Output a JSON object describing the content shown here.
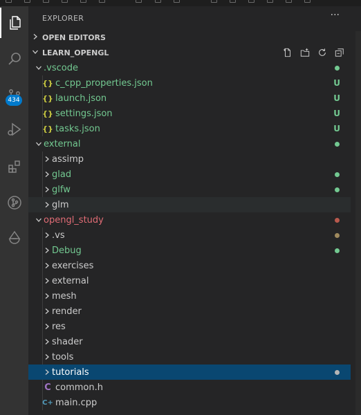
{
  "explorer": {
    "title": "EXPLORER",
    "more_label": "···",
    "open_editors_label": "OPEN EDITORS",
    "workspace_label": "LEARN_OPENGL"
  },
  "activity_bar": {
    "scm_badge": "434"
  },
  "colors": {
    "git_untracked": "#73c991",
    "git_modified_dot": "#73c991",
    "git_conflict_red": "#e06c75",
    "selected_row": "#094771",
    "accent": "#007acc"
  },
  "tree": [
    {
      "name": ".vscode",
      "type": "folder",
      "expanded": true,
      "color": "green",
      "deco": "dot",
      "dot_color": "#73c991"
    },
    {
      "name": "c_cpp_properties.json",
      "type": "json",
      "icon": "{}",
      "color": "green",
      "deco": "U"
    },
    {
      "name": "launch.json",
      "type": "json",
      "icon": "{}",
      "color": "green",
      "deco": "U"
    },
    {
      "name": "settings.json",
      "type": "json",
      "icon": "{}",
      "color": "green",
      "deco": "U"
    },
    {
      "name": "tasks.json",
      "type": "json",
      "icon": "{}",
      "color": "green",
      "deco": "U"
    },
    {
      "name": "external",
      "type": "folder",
      "expanded": true,
      "color": "green",
      "deco": "dot",
      "dot_color": "#73c991"
    },
    {
      "name": "assimp",
      "type": "folder",
      "expanded": false,
      "color": "white"
    },
    {
      "name": "glad",
      "type": "folder",
      "expanded": false,
      "color": "green",
      "deco": "dot",
      "dot_color": "#73c991"
    },
    {
      "name": "glfw",
      "type": "folder",
      "expanded": false,
      "color": "green",
      "deco": "dot",
      "dot_color": "#73c991"
    },
    {
      "name": "glm",
      "type": "folder",
      "expanded": false,
      "color": "white"
    },
    {
      "name": "opengl_study",
      "type": "folder",
      "expanded": true,
      "color": "red",
      "deco": "dot",
      "dot_color": "#b8594d"
    },
    {
      "name": ".vs",
      "type": "folder",
      "expanded": false,
      "color": "white",
      "deco": "dot",
      "dot_color": "#a08a5e"
    },
    {
      "name": "Debug",
      "type": "folder",
      "expanded": false,
      "color": "green",
      "deco": "dot",
      "dot_color": "#73c991"
    },
    {
      "name": "exercises",
      "type": "folder",
      "expanded": false,
      "color": "white"
    },
    {
      "name": "external",
      "type": "folder",
      "expanded": false,
      "color": "white"
    },
    {
      "name": "mesh",
      "type": "folder",
      "expanded": false,
      "color": "white"
    },
    {
      "name": "render",
      "type": "folder",
      "expanded": false,
      "color": "white"
    },
    {
      "name": "res",
      "type": "folder",
      "expanded": false,
      "color": "white"
    },
    {
      "name": "shader",
      "type": "folder",
      "expanded": false,
      "color": "white"
    },
    {
      "name": "tools",
      "type": "folder",
      "expanded": false,
      "color": "white"
    },
    {
      "name": "tutorials",
      "type": "folder",
      "expanded": false,
      "color": "white",
      "deco": "dot",
      "dot_color": "#b5b5b5",
      "selected": true
    },
    {
      "name": "common.h",
      "type": "c-header",
      "icon": "C",
      "icon_color": "#a074c4",
      "color": "white"
    },
    {
      "name": "main.cpp",
      "type": "cpp",
      "icon": "C+",
      "icon_color": "#519aba",
      "color": "white"
    }
  ]
}
